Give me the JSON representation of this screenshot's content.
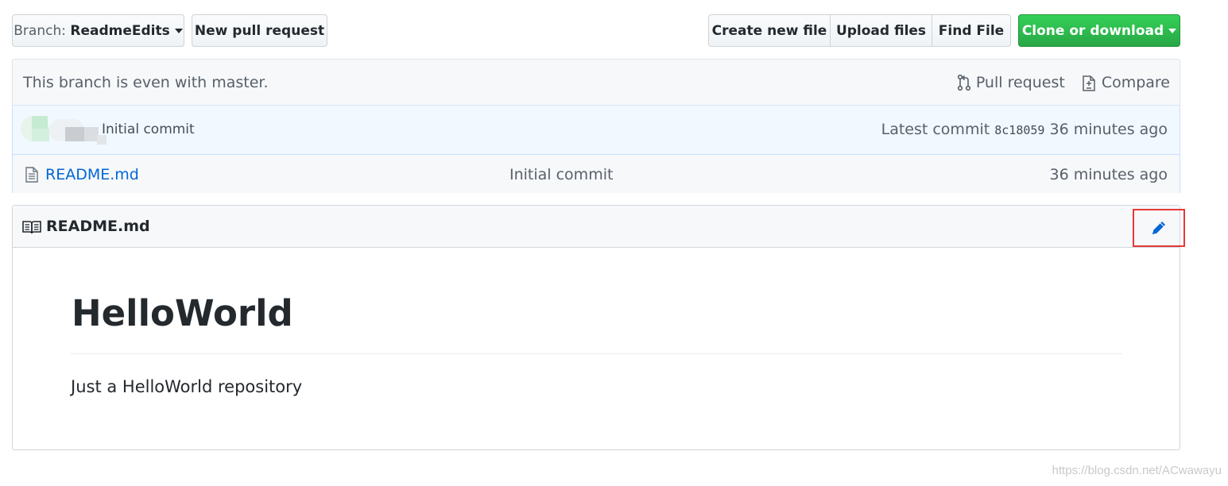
{
  "toolbar": {
    "branch_prefix": "Branch:",
    "branch_name": "ReadmeEdits",
    "new_pull_request": "New pull request",
    "create_new_file": "Create new file",
    "upload_files": "Upload files",
    "find_file": "Find File",
    "clone_or_download": "Clone or download"
  },
  "branch_info": {
    "message": "This branch is even with master.",
    "pull_request": "Pull request",
    "compare": "Compare"
  },
  "commit_tease": {
    "message": "Initial commit",
    "latest_prefix": "Latest commit",
    "sha": "8c18059",
    "age": "36 minutes ago"
  },
  "files": [
    {
      "name": "README.md",
      "message": "Initial commit",
      "age": "36 minutes ago"
    }
  ],
  "readme": {
    "filename": "README.md",
    "heading": "HelloWorld",
    "body": "Just a HelloWorld repository"
  },
  "watermark": "https://blog.csdn.net/ACwawayu",
  "colors": {
    "accent_blue": "#0366d6",
    "clone_green": "#28a745",
    "highlight_red": "#e53935"
  }
}
